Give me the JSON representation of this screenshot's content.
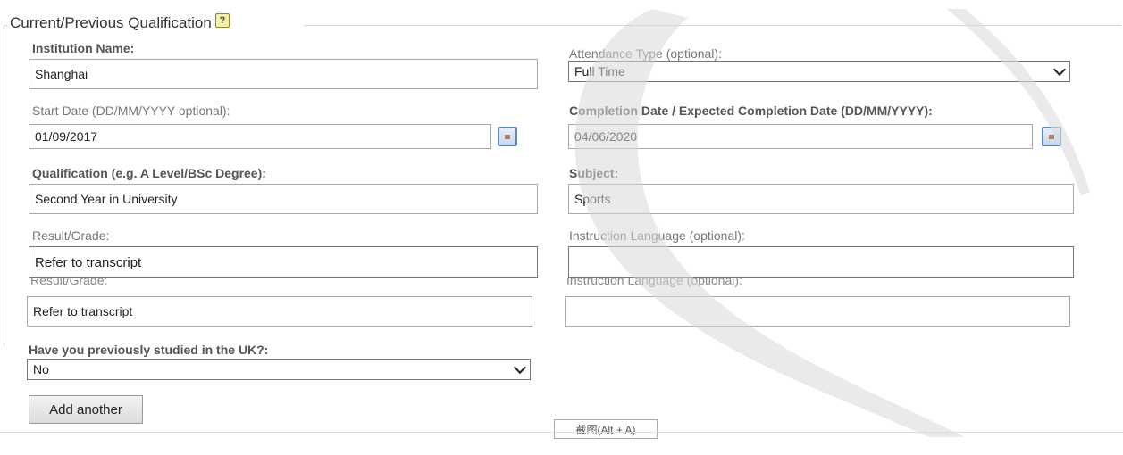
{
  "legend": {
    "title": "Current/Previous Qualification",
    "help_icon": "?"
  },
  "fields": {
    "institution_name": {
      "label": "Institution Name:",
      "value": "Shanghai"
    },
    "attendance_type": {
      "label": "Attendance Type (optional):",
      "value": "Full Time"
    },
    "start_date": {
      "label": "Start Date (DD/MM/YYYY optional):",
      "value": "01/09/2017"
    },
    "completion_date": {
      "label": "Completion Date / Expected Completion Date (DD/MM/YYYY):",
      "value": "04/06/2020"
    },
    "qualification": {
      "label": "Qualification (e.g. A Level/BSc Degree):",
      "value": "Second Year in University"
    },
    "subject": {
      "label": "Subject:",
      "value": "Sports"
    },
    "result_grade": {
      "label": "Result/Grade:",
      "value": "Refer to transcript"
    },
    "instruction_language": {
      "label": "Instruction Language (optional):",
      "value": ""
    },
    "result_grade_dup": {
      "label": "Result/Grade:",
      "value": "Refer to transcript"
    },
    "instruction_language_dup": {
      "label": "Instruction Language (optional):",
      "value": ""
    },
    "previously_studied_uk": {
      "label": "Have you previously studied in the UK?:",
      "value": "No"
    }
  },
  "buttons": {
    "add_another": "Add another"
  },
  "shortcut_tip": "截图(Alt + A)",
  "colors": {
    "field_border": "#a9a9a9",
    "calendar_accent": "#5b89c4",
    "overlay": "#d9d9d9"
  }
}
